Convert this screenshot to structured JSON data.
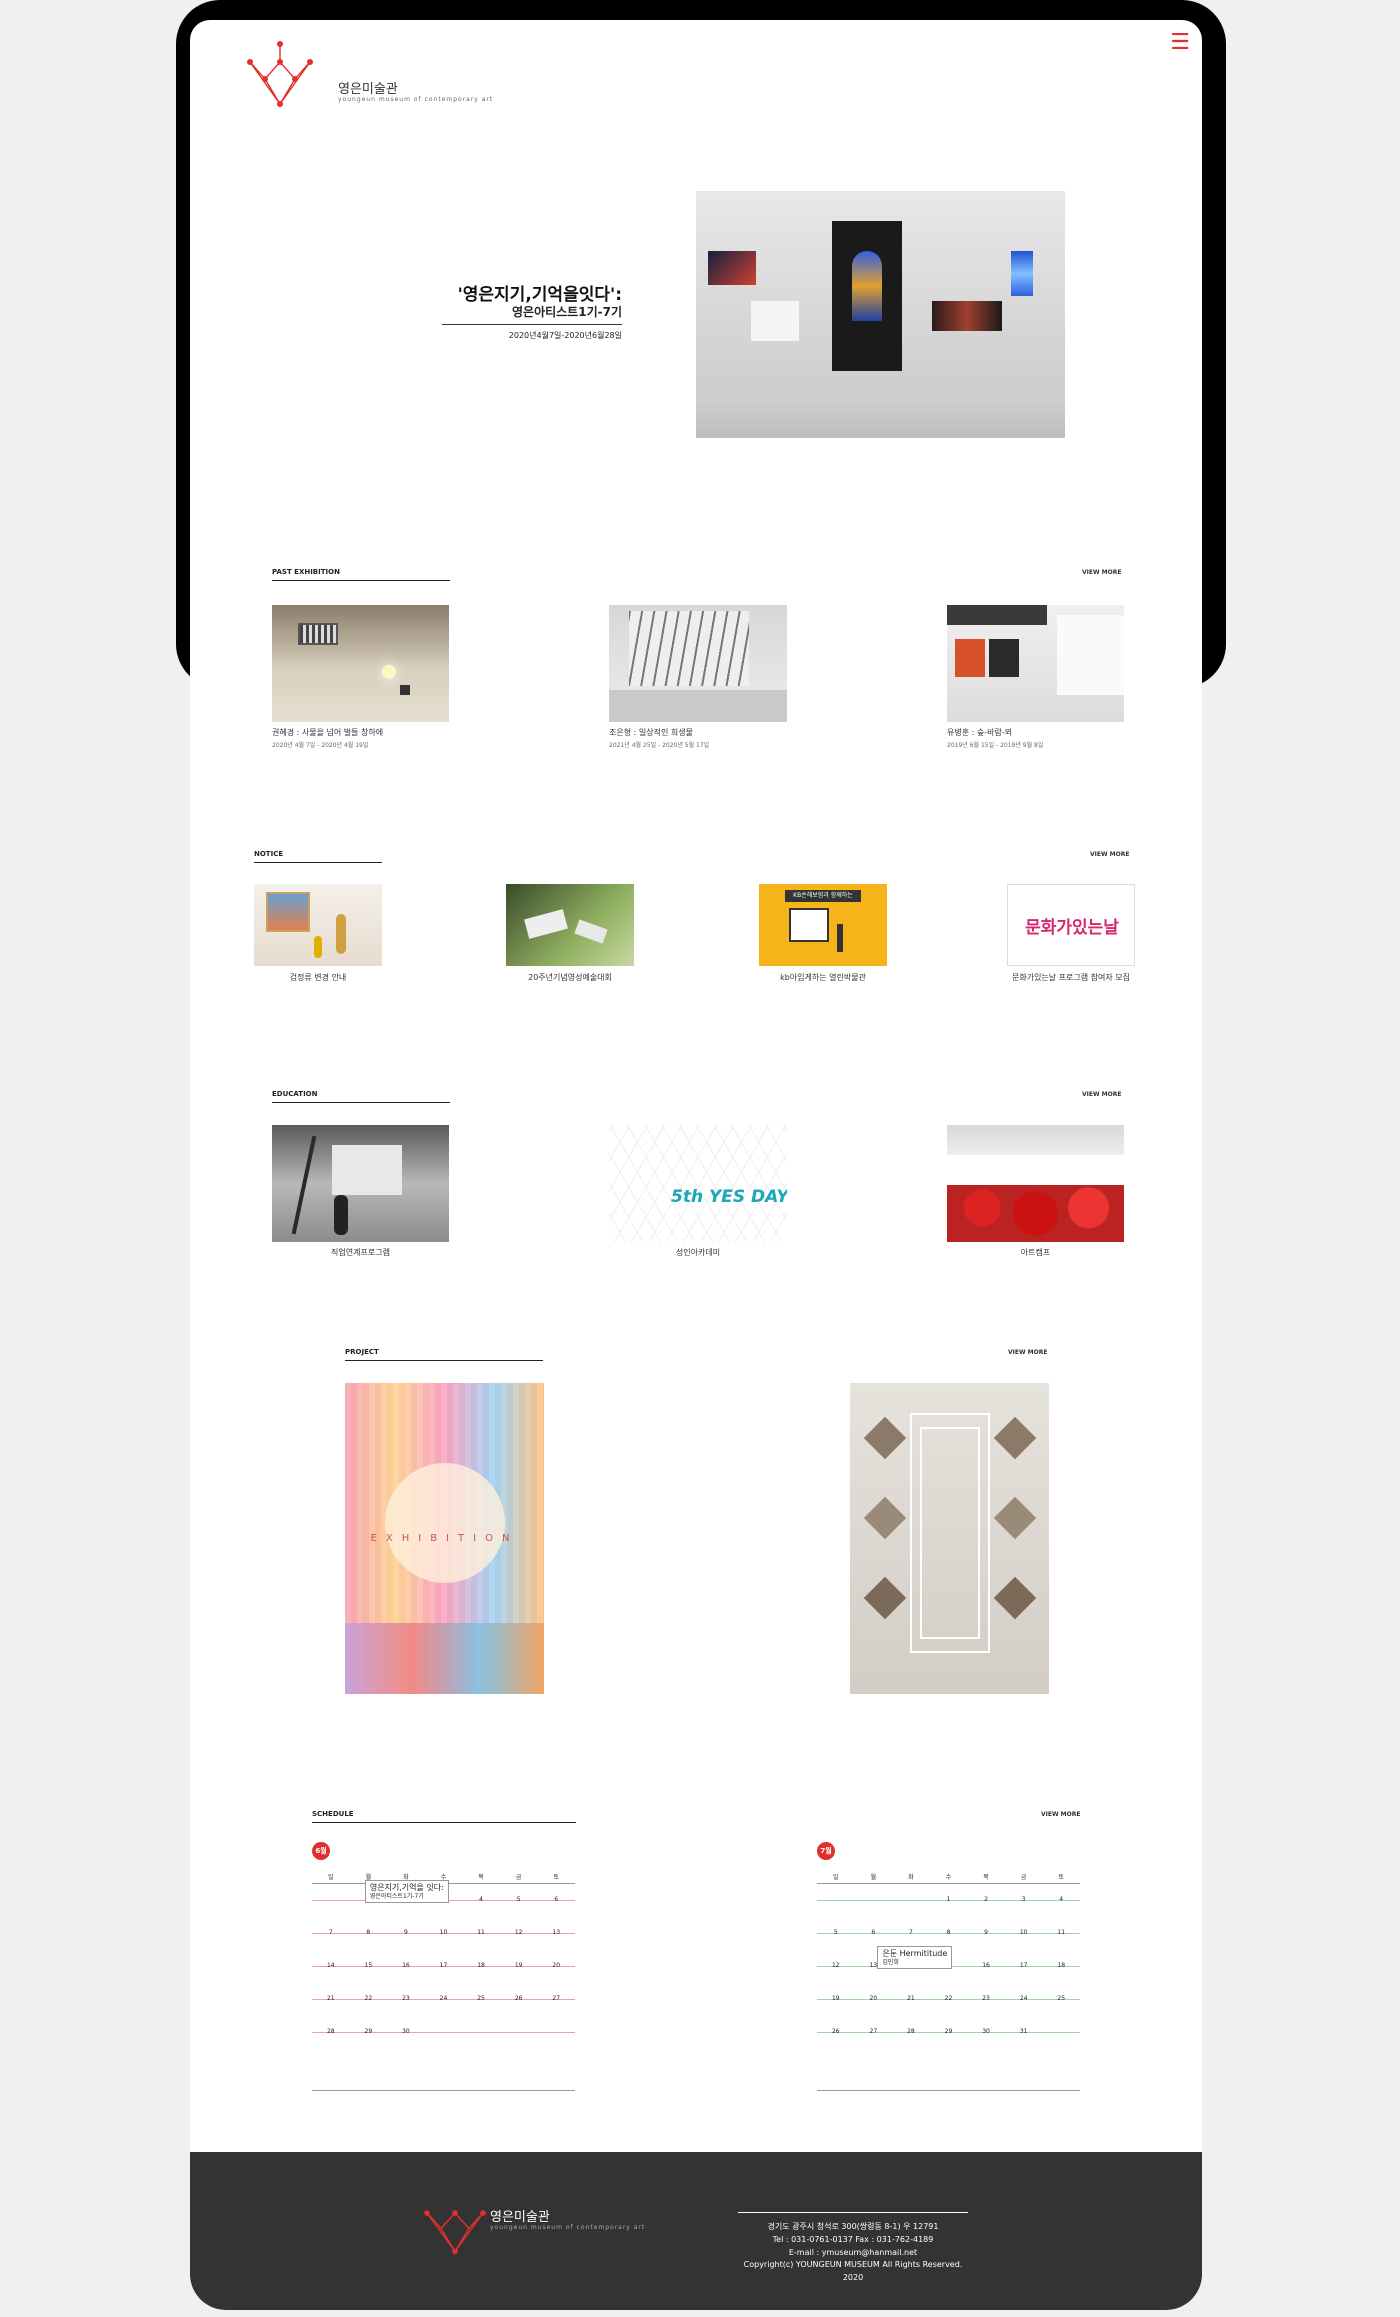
{
  "brand": {
    "name": "영은미술관",
    "sub": "youngeun museum of contemporary art",
    "accent": "#e0302d"
  },
  "hero": {
    "title": "'영은지기,기억을잇다':",
    "subtitle": "영은아티스트1기-7기",
    "date": "2020년4월7일-2020년6월28일"
  },
  "past_exhibition": {
    "title": "PAST EXHIBITION",
    "view_more": "VIEW MORE",
    "items": [
      {
        "title": "권혜경 : 사물을 넘어 벌들 창하에",
        "date": "2020년 4월 7일 - 2020년 4월 19일"
      },
      {
        "title": "조은형 : 일상적인 희생물",
        "date": "2021년 4월 25일 - 2020년 5월 17일"
      },
      {
        "title": "유병훈 : 숲-바람-뫼",
        "date": "2019년 6월 15일 - 2019년 9월 8일"
      }
    ]
  },
  "notice": {
    "title": "NOTICE",
    "view_more": "VIEW MORE",
    "items": [
      {
        "title": "검정류 변경 안내"
      },
      {
        "title": "20주년기념영성예술대회"
      },
      {
        "title": "kb아임게하는 열린박물관"
      },
      {
        "title": "문화가있는날 프로그램 참여자 모집"
      }
    ],
    "img_texts": {
      "kb": "KB손해보험과 함께하는",
      "poster": "문화가있는날"
    }
  },
  "education": {
    "title": "EDUCATION",
    "view_more": "VIEW MORE",
    "items": [
      {
        "title": "직업연계프로그램"
      },
      {
        "title": "성인아카데미"
      },
      {
        "title": "아트캠프"
      }
    ],
    "yes_day": "5th YES DAY"
  },
  "project": {
    "title": "PROJECT",
    "view_more": "VIEW MORE",
    "poster_text": "EXHIBITION"
  },
  "schedule": {
    "title": "SCHEDULE",
    "view_more": "VIEW MORE",
    "weekdays": [
      "일",
      "월",
      "화",
      "수",
      "목",
      "금",
      "토"
    ],
    "june": {
      "badge": "6월",
      "days": [
        "",
        "1",
        "2",
        "3",
        "4",
        "5",
        "6",
        "7",
        "8",
        "9",
        "10",
        "11",
        "12",
        "13",
        "14",
        "15",
        "16",
        "17",
        "18",
        "19",
        "20",
        "21",
        "22",
        "23",
        "24",
        "25",
        "26",
        "27",
        "28",
        "29",
        "30"
      ],
      "popup_title": "영은지기,기억을 잇다:",
      "popup_sub": "영은아티스트1기-7기"
    },
    "july": {
      "badge": "7월",
      "days": [
        "",
        "",
        "",
        "1",
        "2",
        "3",
        "4",
        "5",
        "6",
        "7",
        "8",
        "9",
        "10",
        "11",
        "12",
        "13",
        "14",
        "15",
        "16",
        "17",
        "18",
        "19",
        "20",
        "21",
        "22",
        "23",
        "24",
        "25",
        "26",
        "27",
        "28",
        "29",
        "30",
        "31"
      ],
      "popup_title": "은둔 Hermititude",
      "popup_sub": "김민희"
    }
  },
  "footer": {
    "address": "경기도 광주시 청석로 300(쌍령동 8-1) 우 12791",
    "tel": "Tel : 031-0761-0137  Fax : 031-762-4189",
    "email": "E-mail : ymuseum@hanmail.net",
    "copyright": "Copyright(c) YOUNGEUN MUSEUM All Rights Reserved. 2020"
  }
}
